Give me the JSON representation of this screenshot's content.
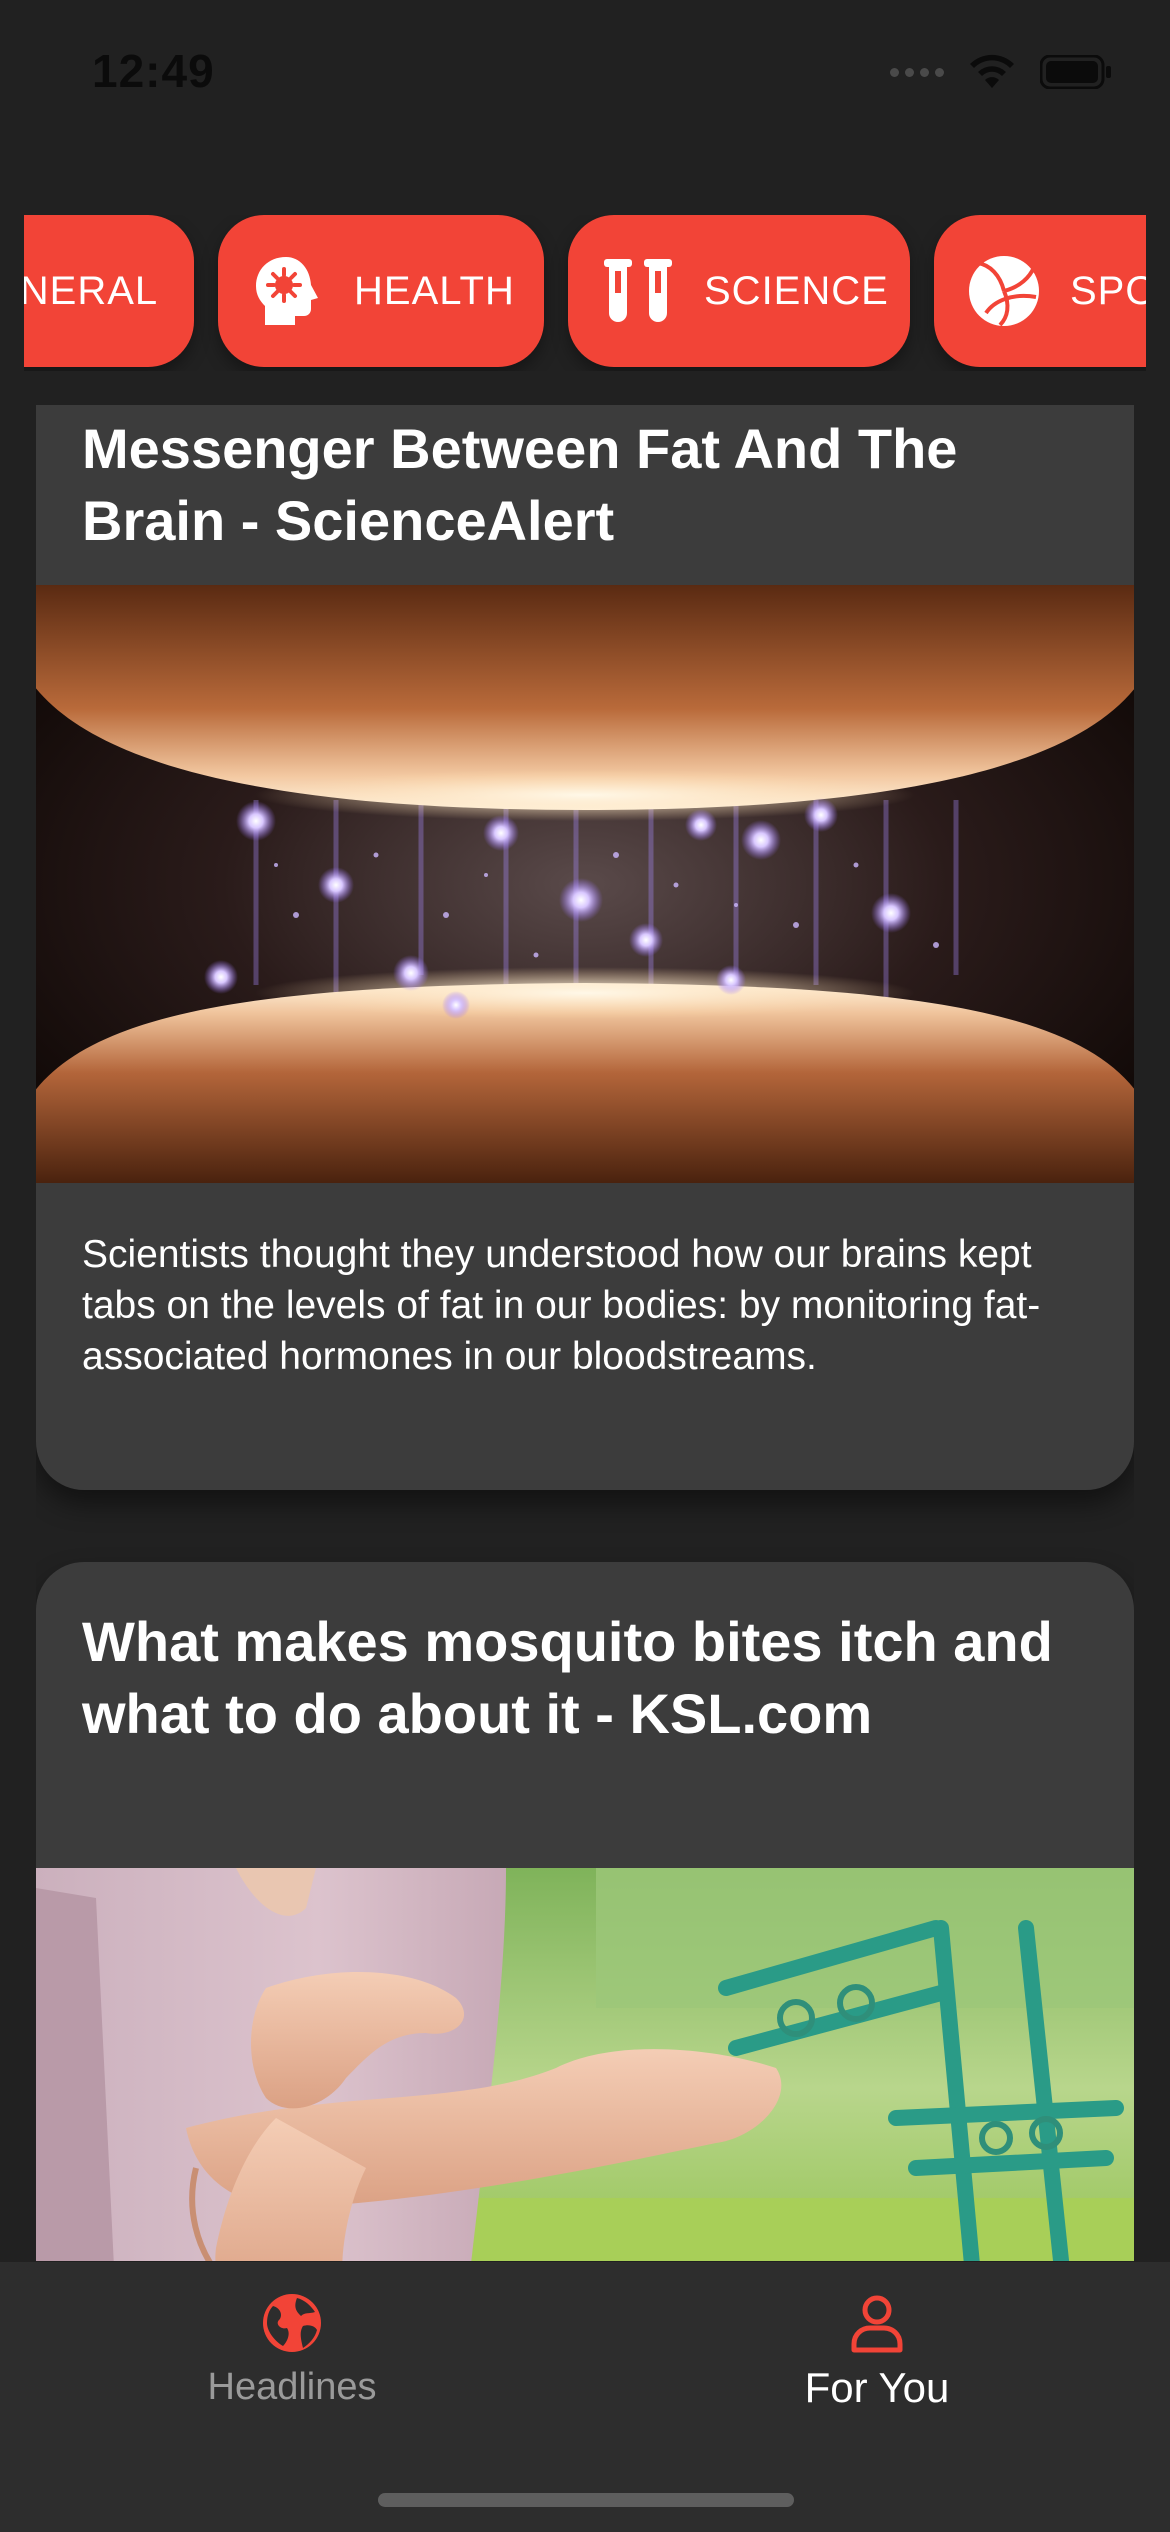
{
  "status_bar": {
    "time": "12:49"
  },
  "categories": [
    {
      "label": "GENERAL",
      "icon": "newspaper-icon"
    },
    {
      "label": "HEALTH",
      "icon": "head-virus-icon"
    },
    {
      "label": "SCIENCE",
      "icon": "test-tubes-icon"
    },
    {
      "label": "SPORTS",
      "icon": "volleyball-icon"
    }
  ],
  "articles": [
    {
      "title": "Messenger Between Fat And The Brain - ScienceAlert",
      "description": "Scientists thought they understood how our brains kept tabs on the levels of fat in our bodies: by monitoring fat-associated hormones in our bloodstreams.",
      "image": "fat-cells-illustration"
    },
    {
      "title": "What makes mosquito bites itch and what to do about it - KSL.com",
      "image": "person-scratching-arm-photo"
    }
  ],
  "tabs": [
    {
      "label": "Headlines",
      "icon": "globe-icon",
      "active": false
    },
    {
      "label": "For You",
      "icon": "person-icon",
      "active": true
    }
  ],
  "colors": {
    "accent": "#f24437",
    "background": "#212121",
    "card": "#3c3c3c",
    "tabbar": "#2d2d2d"
  }
}
